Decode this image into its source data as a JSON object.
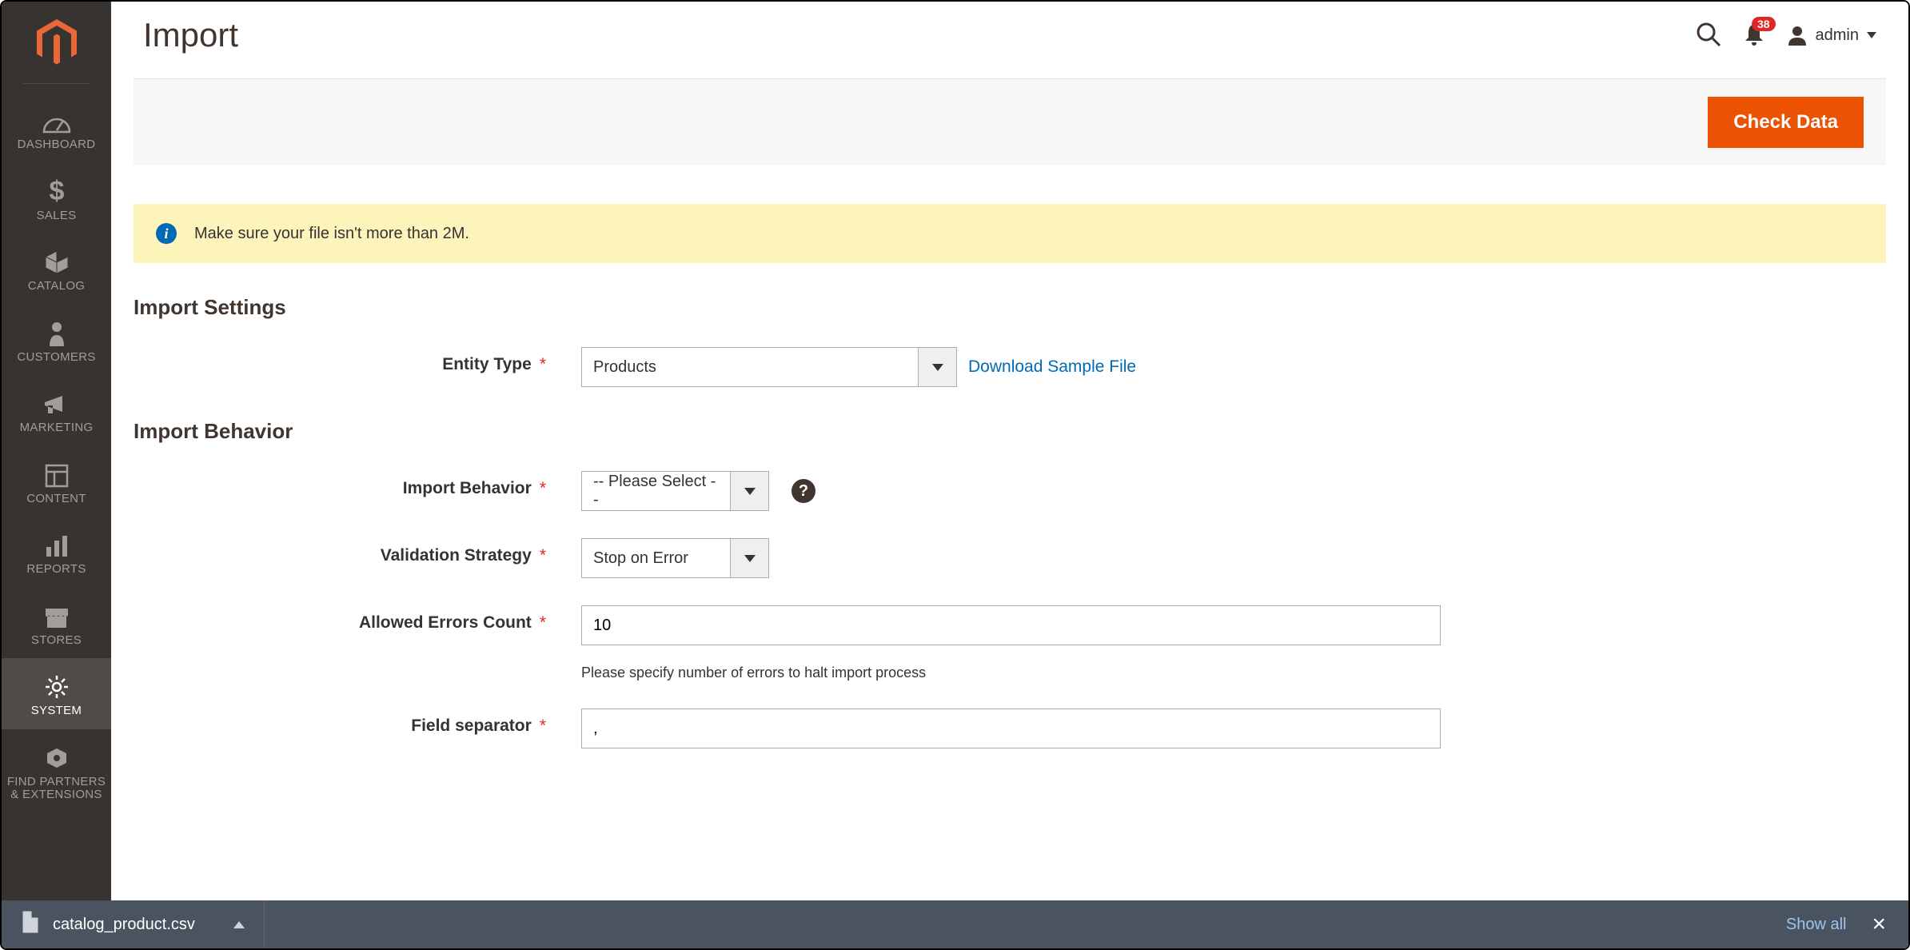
{
  "sidebar": {
    "items": [
      {
        "key": "dashboard",
        "label": "DASHBOARD"
      },
      {
        "key": "sales",
        "label": "SALES"
      },
      {
        "key": "catalog",
        "label": "CATALOG"
      },
      {
        "key": "customers",
        "label": "CUSTOMERS"
      },
      {
        "key": "marketing",
        "label": "MARKETING"
      },
      {
        "key": "content",
        "label": "CONTENT"
      },
      {
        "key": "reports",
        "label": "REPORTS"
      },
      {
        "key": "stores",
        "label": "STORES"
      },
      {
        "key": "system",
        "label": "SYSTEM"
      },
      {
        "key": "partners",
        "label": "FIND PARTNERS & EXTENSIONS"
      }
    ]
  },
  "header": {
    "title": "Import",
    "notification_count": "38",
    "user_label": "admin"
  },
  "actions": {
    "check_data": "Check Data"
  },
  "message": {
    "text": "Make sure your file isn't more than 2M."
  },
  "sections": {
    "settings_heading": "Import Settings",
    "behavior_heading": "Import Behavior"
  },
  "fields": {
    "entity_type": {
      "label": "Entity Type",
      "value": "Products",
      "link": "Download Sample File"
    },
    "import_behavior": {
      "label": "Import Behavior",
      "value": "-- Please Select --"
    },
    "validation_strategy": {
      "label": "Validation Strategy",
      "value": "Stop on Error"
    },
    "allowed_errors": {
      "label": "Allowed Errors Count",
      "value": "10",
      "hint": "Please specify number of errors to halt import process"
    },
    "field_separator": {
      "label": "Field separator",
      "value": ","
    }
  },
  "download_bar": {
    "filename": "catalog_product.csv",
    "show_all": "Show all"
  }
}
